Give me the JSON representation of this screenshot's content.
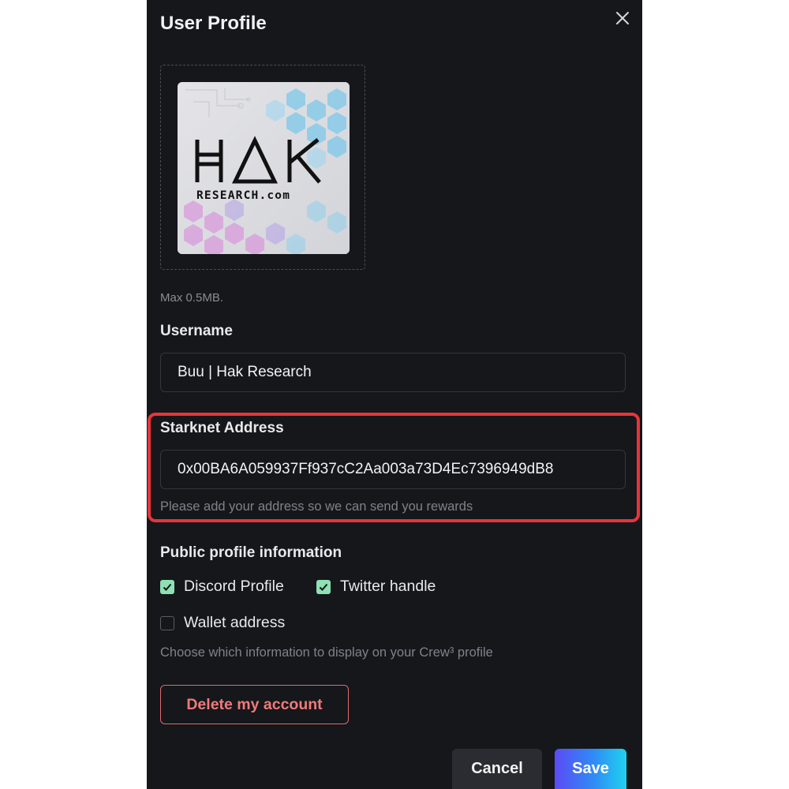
{
  "modal": {
    "title": "User Profile",
    "close_icon": "close-icon"
  },
  "avatar": {
    "logo_text": "HAK",
    "logo_subtext": "RESEARCH.com",
    "max_size_hint": "Max 0.5MB."
  },
  "username": {
    "label": "Username",
    "value": "Buu | Hak Research"
  },
  "starknet": {
    "label": "Starknet Address",
    "value": "0x00BA6A059937Ff937cC2Aa003a73D4Ec7396949dB8",
    "helper": "Please add your address so we can send you rewards"
  },
  "public_profile": {
    "heading": "Public profile information",
    "options": [
      {
        "label": "Discord Profile",
        "checked": true
      },
      {
        "label": "Twitter handle",
        "checked": true
      },
      {
        "label": "Wallet address",
        "checked": false
      }
    ],
    "helper": "Choose which information to display on your Crew³ profile"
  },
  "actions": {
    "delete_label": "Delete my account",
    "cancel_label": "Cancel",
    "save_label": "Save"
  },
  "colors": {
    "modal_background": "#15171b",
    "highlight_border": "#e8343b",
    "checkbox_checked": "#8fe0b3",
    "delete_accent": "#e06b6b"
  }
}
